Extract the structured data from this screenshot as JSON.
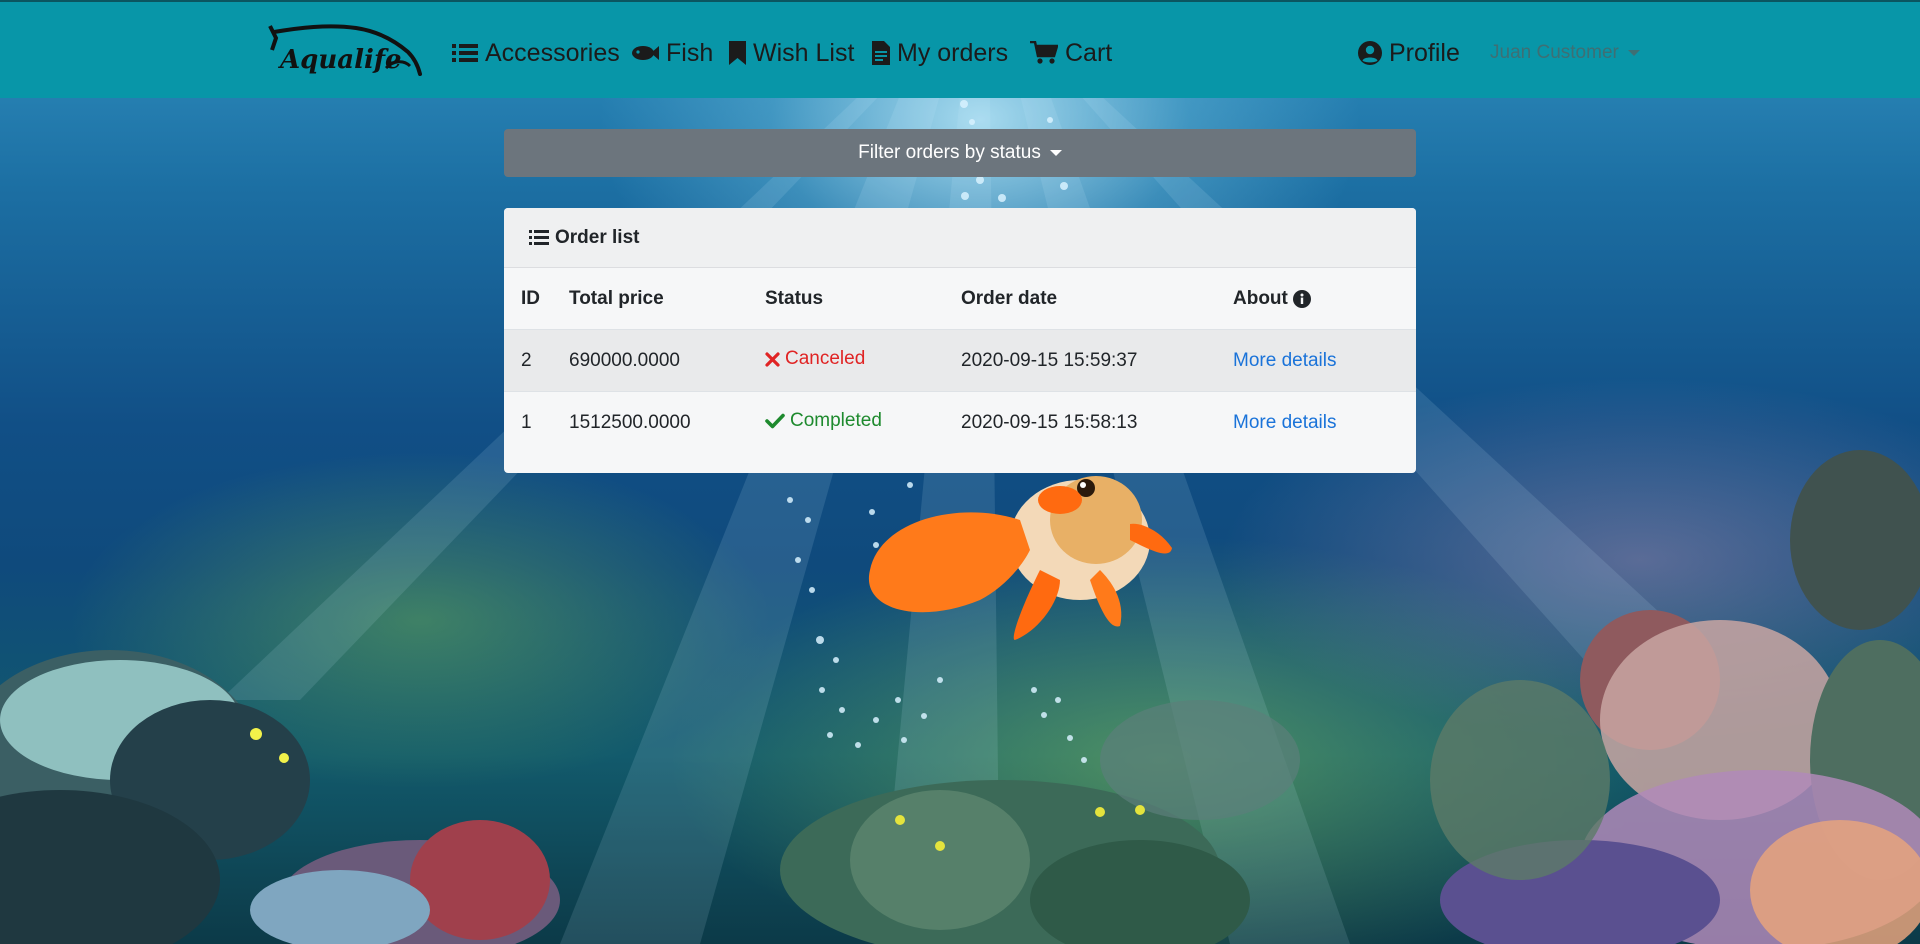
{
  "brand": {
    "logo_text": "Aqualife"
  },
  "nav": {
    "items": [
      {
        "label": "Accessories",
        "icon": "list-icon"
      },
      {
        "label": "Fish",
        "icon": "fish-icon"
      },
      {
        "label": "Wish List",
        "icon": "bookmark-icon"
      },
      {
        "label": "My orders",
        "icon": "file-invoice-icon"
      },
      {
        "label": "Cart",
        "icon": "cart-icon"
      }
    ],
    "profile_label": "Profile",
    "user_name": "Juan Customer"
  },
  "filter": {
    "label": "Filter orders by status"
  },
  "orders_card": {
    "title": "Order list",
    "columns": [
      "ID",
      "Total price",
      "Status",
      "Order date",
      "About"
    ],
    "rows": [
      {
        "id": "2",
        "total_price": "690000.0000",
        "status": "Canceled",
        "order_date": "2020-09-15 15:59:37",
        "link": "More details"
      },
      {
        "id": "1",
        "total_price": "1512500.0000",
        "status": "Completed",
        "order_date": "2020-09-15 15:58:13",
        "link": "More details"
      }
    ]
  },
  "colors": {
    "navbar": "#0896a8",
    "filter_button": "#6c757d",
    "canceled": "#e02424",
    "completed": "#1e8a2e",
    "link": "#1a73d9"
  }
}
